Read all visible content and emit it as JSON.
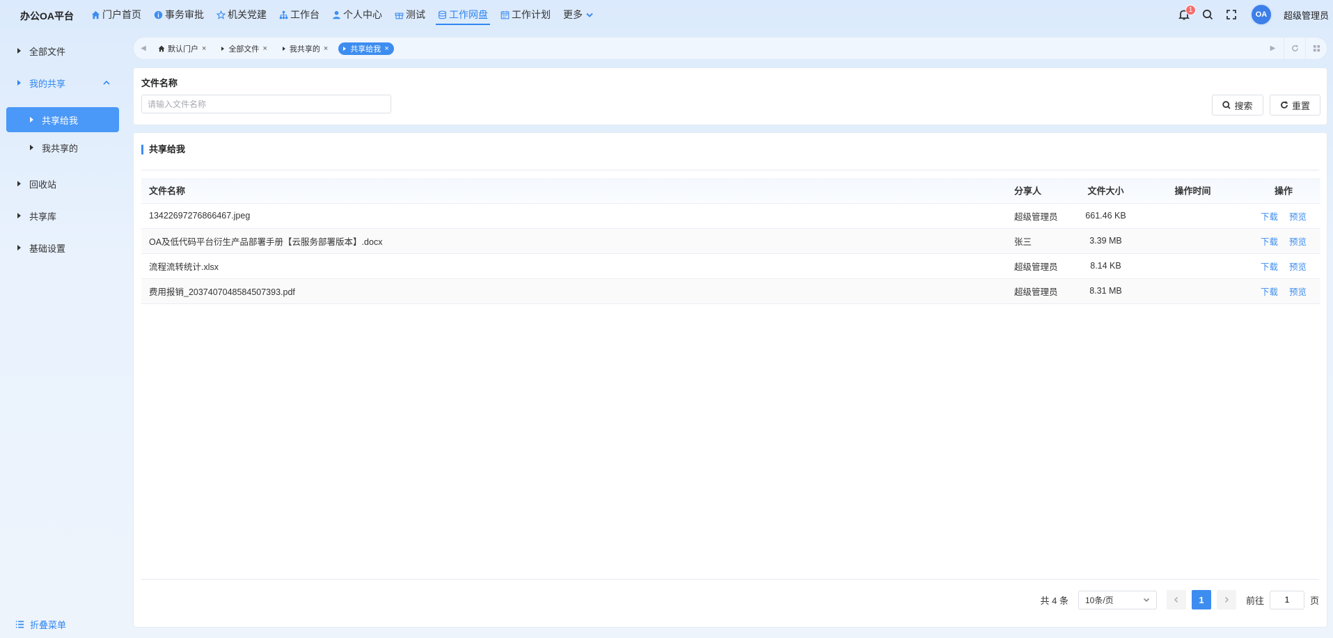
{
  "brand": "办公OA平台",
  "nav": [
    {
      "label": "门户首页",
      "icon": "home-icon"
    },
    {
      "label": "事务审批",
      "icon": "info-icon"
    },
    {
      "label": "机关党建",
      "icon": "star-icon"
    },
    {
      "label": "工作台",
      "icon": "org-icon"
    },
    {
      "label": "个人中心",
      "icon": "user-icon"
    },
    {
      "label": "测试",
      "icon": "gift-icon"
    },
    {
      "label": "工作网盘",
      "icon": "database-icon",
      "active": true
    },
    {
      "label": "工作计划",
      "icon": "calendar-icon"
    },
    {
      "label": "更多",
      "icon": "chevron-down-icon"
    }
  ],
  "top_right": {
    "notification_count": "1",
    "avatar_text": "OA",
    "username": "超级管理员"
  },
  "sidebar": {
    "items": [
      {
        "label": "全部文件"
      },
      {
        "label": "我的共享"
      },
      {
        "label": "共享给我"
      },
      {
        "label": "我共享的"
      },
      {
        "label": "回收站"
      },
      {
        "label": "共享库"
      },
      {
        "label": "基础设置"
      }
    ],
    "collapse_label": "折叠菜单"
  },
  "tabs": [
    {
      "label": "默认门户"
    },
    {
      "label": "全部文件"
    },
    {
      "label": "我共享的"
    },
    {
      "label": "共享给我"
    }
  ],
  "search": {
    "field_label": "文件名称",
    "placeholder": "请输入文件名称",
    "search_button": "搜索",
    "reset_button": "重置"
  },
  "table": {
    "section_title": "共享给我",
    "headers": [
      "文件名称",
      "分享人",
      "文件大小",
      "操作时间",
      "操作"
    ],
    "rows": [
      {
        "name": "13422697276866467.jpeg",
        "sharer": "超级管理员",
        "size": "661.46 KB",
        "time": "",
        "op1": "下载",
        "op2": "预览"
      },
      {
        "name": "OA及低代码平台衍生产品部署手册【云服务部署版本】.docx",
        "sharer": "张三",
        "size": "3.39 MB",
        "time": "",
        "op1": "下载",
        "op2": "预览"
      },
      {
        "name": "流程流转统计.xlsx",
        "sharer": "超级管理员",
        "size": "8.14 KB",
        "time": "",
        "op1": "下载",
        "op2": "预览"
      },
      {
        "name": "费用报销_2037407048584507393.pdf",
        "sharer": "超级管理员",
        "size": "8.31 MB",
        "time": "",
        "op1": "下载",
        "op2": "预览"
      }
    ]
  },
  "pagination": {
    "total": "共 4 条",
    "page_size": "10条/页",
    "current_page": "1",
    "goto_label": "前往",
    "goto_value": "1",
    "page_unit": "页"
  },
  "colors": {
    "accent": "#3d8df0",
    "selected_bg": "#4a98f7",
    "badge": "#f56c6c"
  }
}
